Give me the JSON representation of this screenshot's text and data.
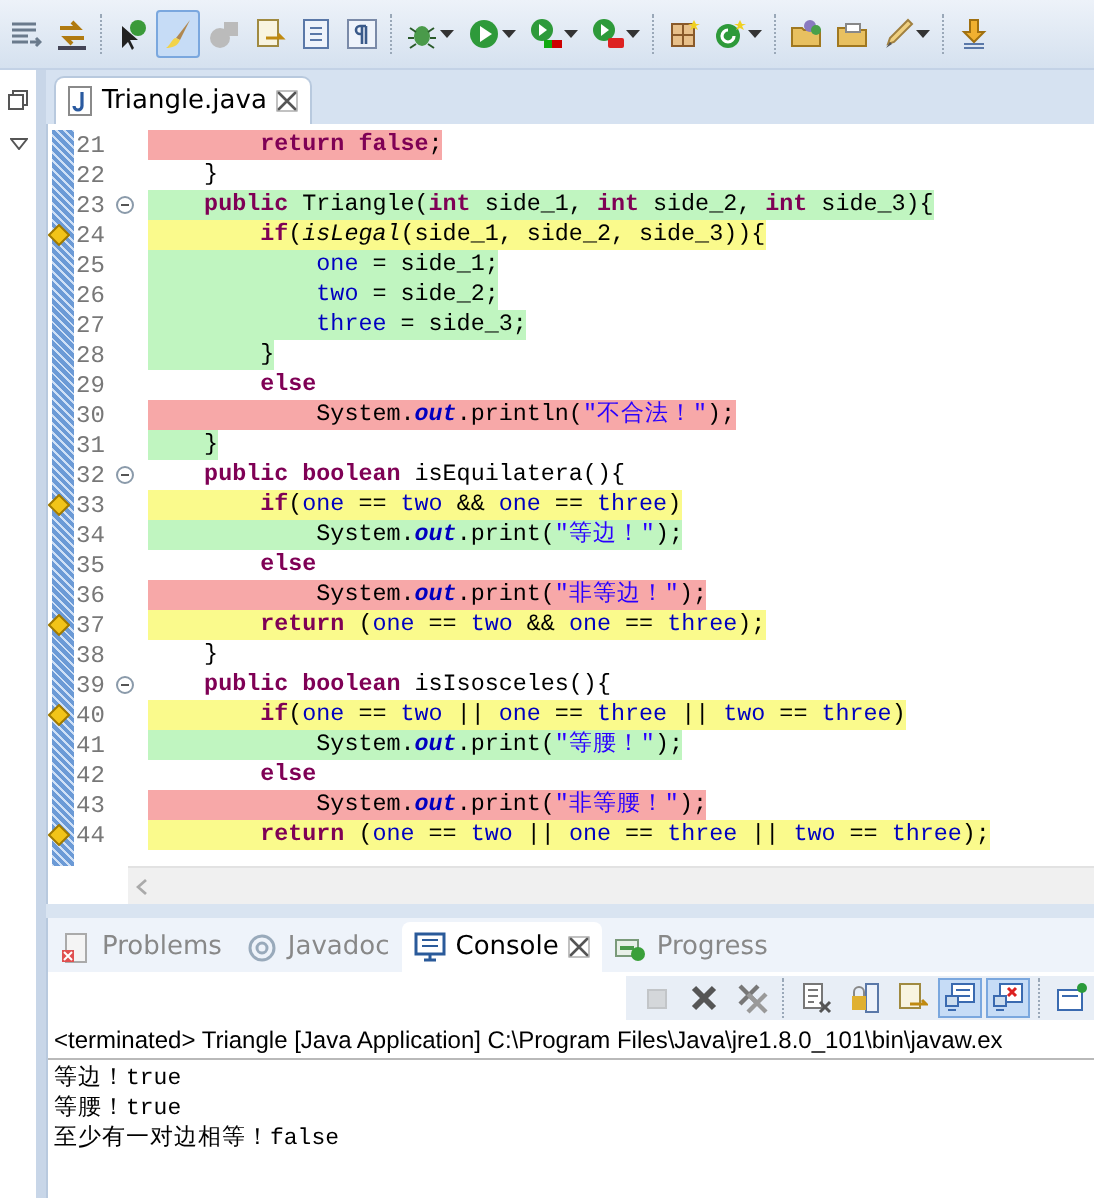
{
  "toolbar": [
    {
      "kind": "lines",
      "dropdown": false,
      "selected": false
    },
    {
      "kind": "goto",
      "dropdown": false,
      "selected": false
    },
    {
      "kind": "separator"
    },
    {
      "kind": "coverage-pin",
      "dropdown": false,
      "selected": false
    },
    {
      "kind": "brush",
      "dropdown": false,
      "selected": true
    },
    {
      "kind": "shapes",
      "dropdown": false,
      "selected": false
    },
    {
      "kind": "doc-arrow",
      "dropdown": false,
      "selected": false
    },
    {
      "kind": "doc",
      "dropdown": false,
      "selected": false
    },
    {
      "kind": "pilcrow",
      "dropdown": false,
      "selected": false
    },
    {
      "kind": "separator"
    },
    {
      "kind": "bug",
      "dropdown": true,
      "selected": false
    },
    {
      "kind": "play",
      "dropdown": true,
      "selected": false
    },
    {
      "kind": "play-bar",
      "dropdown": true,
      "selected": false
    },
    {
      "kind": "play-case",
      "dropdown": true,
      "selected": false
    },
    {
      "kind": "separator"
    },
    {
      "kind": "grid",
      "dropdown": false,
      "selected": false
    },
    {
      "kind": "refresh",
      "dropdown": true,
      "selected": false
    },
    {
      "kind": "separator"
    },
    {
      "kind": "folder-ball",
      "dropdown": false,
      "selected": false
    },
    {
      "kind": "folder",
      "dropdown": false,
      "selected": false
    },
    {
      "kind": "pen",
      "dropdown": true,
      "selected": false
    },
    {
      "kind": "separator"
    },
    {
      "kind": "download",
      "dropdown": false,
      "selected": false
    }
  ],
  "editor": {
    "tab": {
      "label": "Triangle.java",
      "selected": true
    },
    "lines": [
      {
        "number": "21",
        "kind": "missed",
        "branch": false,
        "fold": false,
        "tokens": [
          {
            "text": "        return",
            "kind": "keyword"
          },
          {
            "text": " false",
            "kind": "keyword"
          },
          {
            "text": ";",
            "kind": "plain"
          }
        ]
      },
      {
        "number": "22",
        "kind": "none",
        "branch": false,
        "fold": false,
        "tokens": [
          {
            "text": "    }",
            "kind": "plain"
          }
        ]
      },
      {
        "number": "23",
        "kind": "covered",
        "branch": false,
        "fold": true,
        "tokens": [
          {
            "text": "    public",
            "kind": "keyword"
          },
          {
            "text": " Triangle(",
            "kind": "plain"
          },
          {
            "text": "int",
            "kind": "keyword"
          },
          {
            "text": " side_1, ",
            "kind": "plain"
          },
          {
            "text": "int",
            "kind": "keyword"
          },
          {
            "text": " side_2, ",
            "kind": "plain"
          },
          {
            "text": "int",
            "kind": "keyword"
          },
          {
            "text": " side_3){",
            "kind": "plain"
          }
        ]
      },
      {
        "number": "24",
        "kind": "partial",
        "branch": true,
        "fold": false,
        "tokens": [
          {
            "text": "        if",
            "kind": "keyword"
          },
          {
            "text": "(",
            "kind": "plain"
          },
          {
            "text": "isLegal",
            "kind": "method"
          },
          {
            "text": "(side_1, side_2, side_3)){",
            "kind": "plain"
          }
        ]
      },
      {
        "number": "25",
        "kind": "covered",
        "branch": false,
        "fold": false,
        "tokens": [
          {
            "text": "            one",
            "kind": "field"
          },
          {
            "text": " = side_1;",
            "kind": "plain"
          }
        ]
      },
      {
        "number": "26",
        "kind": "covered",
        "branch": false,
        "fold": false,
        "tokens": [
          {
            "text": "            two",
            "kind": "field"
          },
          {
            "text": " = side_2;",
            "kind": "plain"
          }
        ]
      },
      {
        "number": "27",
        "kind": "covered",
        "branch": false,
        "fold": false,
        "tokens": [
          {
            "text": "            three",
            "kind": "field"
          },
          {
            "text": " = side_3;",
            "kind": "plain"
          }
        ]
      },
      {
        "number": "28",
        "kind": "covered",
        "branch": false,
        "fold": false,
        "tokens": [
          {
            "text": "        }",
            "kind": "plain"
          }
        ]
      },
      {
        "number": "29",
        "kind": "none",
        "branch": false,
        "fold": false,
        "tokens": [
          {
            "text": "        else",
            "kind": "keyword"
          }
        ]
      },
      {
        "number": "30",
        "kind": "missed",
        "branch": false,
        "fold": false,
        "tokens": [
          {
            "text": "            System.",
            "kind": "plain"
          },
          {
            "text": "out",
            "kind": "static"
          },
          {
            "text": ".println(",
            "kind": "plain"
          },
          {
            "text": "\"不合法！\"",
            "kind": "string"
          },
          {
            "text": ");",
            "kind": "plain"
          }
        ]
      },
      {
        "number": "31",
        "kind": "covered",
        "branch": false,
        "fold": false,
        "tokens": [
          {
            "text": "    }",
            "kind": "plain"
          }
        ]
      },
      {
        "number": "32",
        "kind": "none",
        "branch": false,
        "fold": true,
        "tokens": [
          {
            "text": "    public",
            "kind": "keyword"
          },
          {
            "text": " boolean",
            "kind": "keyword"
          },
          {
            "text": " isEquilatera(){",
            "kind": "plain"
          }
        ]
      },
      {
        "number": "33",
        "kind": "partial",
        "branch": true,
        "fold": false,
        "tokens": [
          {
            "text": "        if",
            "kind": "keyword"
          },
          {
            "text": "(",
            "kind": "plain"
          },
          {
            "text": "one",
            "kind": "field"
          },
          {
            "text": " == ",
            "kind": "plain"
          },
          {
            "text": "two",
            "kind": "field"
          },
          {
            "text": " && ",
            "kind": "plain"
          },
          {
            "text": "one",
            "kind": "field"
          },
          {
            "text": " == ",
            "kind": "plain"
          },
          {
            "text": "three",
            "kind": "field"
          },
          {
            "text": ")",
            "kind": "plain"
          }
        ]
      },
      {
        "number": "34",
        "kind": "covered",
        "branch": false,
        "fold": false,
        "tokens": [
          {
            "text": "            System.",
            "kind": "plain"
          },
          {
            "text": "out",
            "kind": "static"
          },
          {
            "text": ".print(",
            "kind": "plain"
          },
          {
            "text": "\"等边！\"",
            "kind": "string"
          },
          {
            "text": ");",
            "kind": "plain"
          }
        ]
      },
      {
        "number": "35",
        "kind": "none",
        "branch": false,
        "fold": false,
        "tokens": [
          {
            "text": "        else",
            "kind": "keyword"
          }
        ]
      },
      {
        "number": "36",
        "kind": "missed",
        "branch": false,
        "fold": false,
        "tokens": [
          {
            "text": "            System.",
            "kind": "plain"
          },
          {
            "text": "out",
            "kind": "static"
          },
          {
            "text": ".print(",
            "kind": "plain"
          },
          {
            "text": "\"非等边！\"",
            "kind": "string"
          },
          {
            "text": ");",
            "kind": "plain"
          }
        ]
      },
      {
        "number": "37",
        "kind": "partial",
        "branch": true,
        "fold": false,
        "tokens": [
          {
            "text": "        return",
            "kind": "keyword"
          },
          {
            "text": " (",
            "kind": "plain"
          },
          {
            "text": "one",
            "kind": "field"
          },
          {
            "text": " == ",
            "kind": "plain"
          },
          {
            "text": "two",
            "kind": "field"
          },
          {
            "text": " && ",
            "kind": "plain"
          },
          {
            "text": "one",
            "kind": "field"
          },
          {
            "text": " == ",
            "kind": "plain"
          },
          {
            "text": "three",
            "kind": "field"
          },
          {
            "text": ");",
            "kind": "plain"
          }
        ]
      },
      {
        "number": "38",
        "kind": "none",
        "branch": false,
        "fold": false,
        "tokens": [
          {
            "text": "    }",
            "kind": "plain"
          }
        ]
      },
      {
        "number": "39",
        "kind": "none",
        "branch": false,
        "fold": true,
        "tokens": [
          {
            "text": "    public",
            "kind": "keyword"
          },
          {
            "text": " boolean",
            "kind": "keyword"
          },
          {
            "text": " isIsosceles(){",
            "kind": "plain"
          }
        ]
      },
      {
        "number": "40",
        "kind": "partial",
        "branch": true,
        "fold": false,
        "tokens": [
          {
            "text": "        if",
            "kind": "keyword"
          },
          {
            "text": "(",
            "kind": "plain"
          },
          {
            "text": "one",
            "kind": "field"
          },
          {
            "text": " == ",
            "kind": "plain"
          },
          {
            "text": "two",
            "kind": "field"
          },
          {
            "text": " || ",
            "kind": "plain"
          },
          {
            "text": "one",
            "kind": "field"
          },
          {
            "text": " == ",
            "kind": "plain"
          },
          {
            "text": "three",
            "kind": "field"
          },
          {
            "text": " || ",
            "kind": "plain"
          },
          {
            "text": "two",
            "kind": "field"
          },
          {
            "text": " == ",
            "kind": "plain"
          },
          {
            "text": "three",
            "kind": "field"
          },
          {
            "text": ")",
            "kind": "plain"
          }
        ]
      },
      {
        "number": "41",
        "kind": "covered",
        "branch": false,
        "fold": false,
        "tokens": [
          {
            "text": "            System.",
            "kind": "plain"
          },
          {
            "text": "out",
            "kind": "static"
          },
          {
            "text": ".print(",
            "kind": "plain"
          },
          {
            "text": "\"等腰！\"",
            "kind": "string"
          },
          {
            "text": ");",
            "kind": "plain"
          }
        ]
      },
      {
        "number": "42",
        "kind": "none",
        "branch": false,
        "fold": false,
        "tokens": [
          {
            "text": "        else",
            "kind": "keyword"
          }
        ]
      },
      {
        "number": "43",
        "kind": "missed",
        "branch": false,
        "fold": false,
        "tokens": [
          {
            "text": "            System.",
            "kind": "plain"
          },
          {
            "text": "out",
            "kind": "static"
          },
          {
            "text": ".print(",
            "kind": "plain"
          },
          {
            "text": "\"非等腰！\"",
            "kind": "string"
          },
          {
            "text": ");",
            "kind": "plain"
          }
        ]
      },
      {
        "number": "44",
        "kind": "partial",
        "branch": true,
        "fold": false,
        "tokens": [
          {
            "text": "        return",
            "kind": "keyword"
          },
          {
            "text": " (",
            "kind": "plain"
          },
          {
            "text": "one",
            "kind": "field"
          },
          {
            "text": " == ",
            "kind": "plain"
          },
          {
            "text": "two",
            "kind": "field"
          },
          {
            "text": " || ",
            "kind": "plain"
          },
          {
            "text": "one",
            "kind": "field"
          },
          {
            "text": " == ",
            "kind": "plain"
          },
          {
            "text": "three",
            "kind": "field"
          },
          {
            "text": " || ",
            "kind": "plain"
          },
          {
            "text": "two",
            "kind": "field"
          },
          {
            "text": " == ",
            "kind": "plain"
          },
          {
            "text": "three",
            "kind": "field"
          },
          {
            "text": ");",
            "kind": "plain"
          }
        ]
      }
    ]
  },
  "bottom_tabs": [
    {
      "kind": "problems",
      "label": "Problems",
      "selected": false
    },
    {
      "kind": "javadoc",
      "label": "Javadoc",
      "selected": false
    },
    {
      "kind": "console",
      "label": "Console",
      "selected": true
    },
    {
      "kind": "progress",
      "label": "Progress",
      "selected": false
    }
  ],
  "console_toolbar": [
    {
      "kind": "stop",
      "disabled": true,
      "selected": false
    },
    {
      "kind": "remove",
      "disabled": false,
      "selected": false
    },
    {
      "kind": "remove-all",
      "disabled": false,
      "selected": false
    },
    {
      "kind": "separator"
    },
    {
      "kind": "clear",
      "disabled": false,
      "selected": false
    },
    {
      "kind": "lock",
      "disabled": false,
      "selected": false
    },
    {
      "kind": "pin-doc",
      "disabled": false,
      "selected": false
    },
    {
      "kind": "show-out",
      "disabled": false,
      "selected": true
    },
    {
      "kind": "show-err",
      "disabled": false,
      "selected": true
    },
    {
      "kind": "separator"
    },
    {
      "kind": "open-console",
      "disabled": false,
      "selected": false
    }
  ],
  "console": {
    "header": "<terminated> Triangle [Java Application] C:\\Program Files\\Java\\jre1.8.0_101\\bin\\javaw.ex",
    "output": [
      "等边！true",
      "等腰！true",
      "至少有一对边相等！false"
    ]
  }
}
